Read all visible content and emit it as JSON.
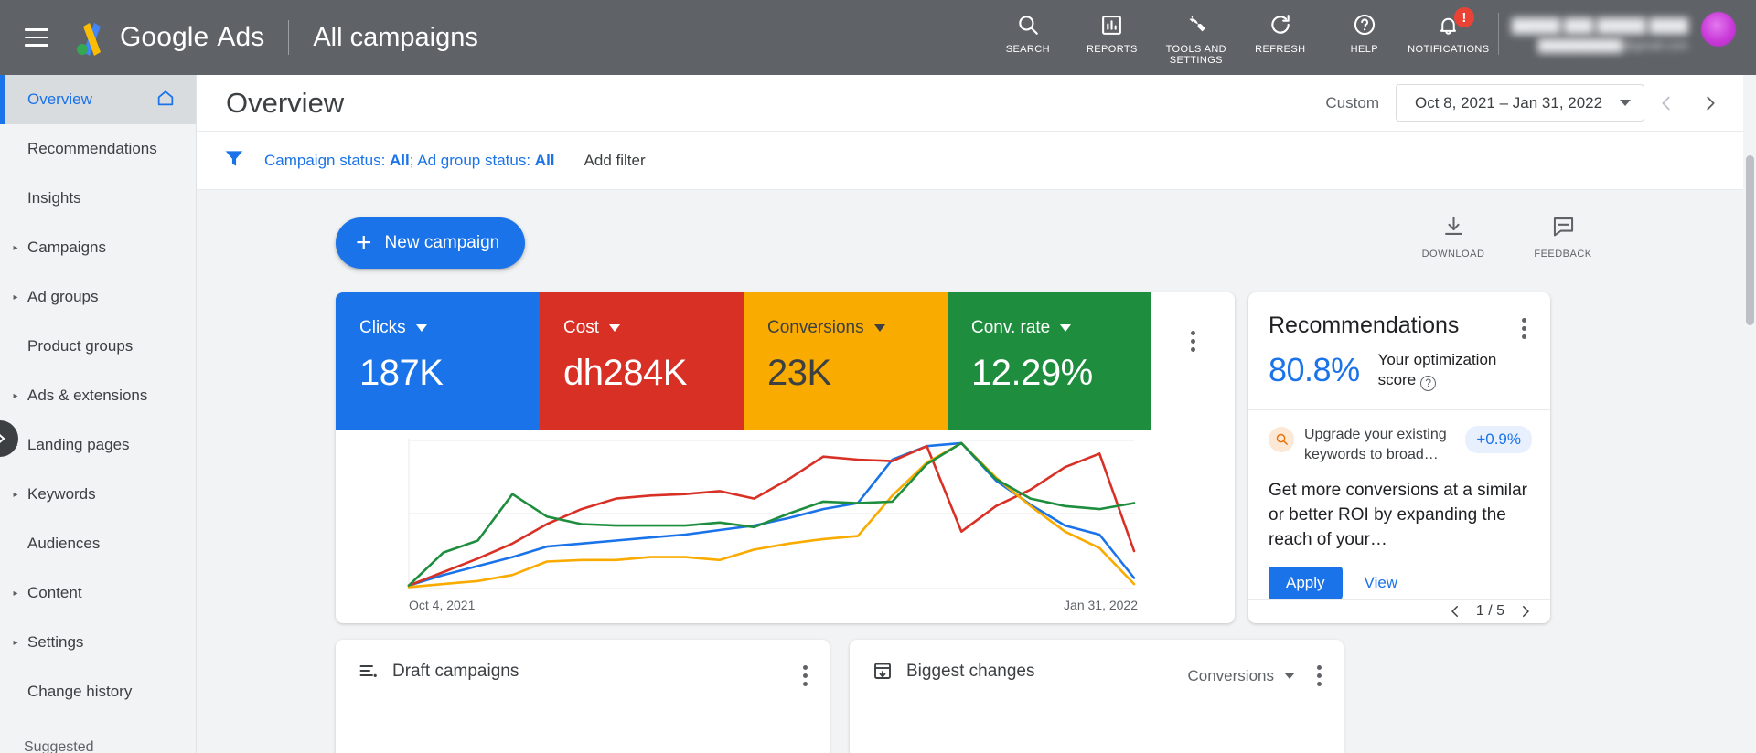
{
  "topbar": {
    "menu_icon": "hamburger-menu-icon",
    "logo_icon": "google-ads-logo",
    "brand_google": "Google",
    "brand_ads": "Ads",
    "page_context": "All campaigns",
    "actions": [
      {
        "label": "SEARCH",
        "icon": "search-icon"
      },
      {
        "label": "REPORTS",
        "icon": "bar-chart-icon"
      },
      {
        "label": "TOOLS AND SETTINGS",
        "icon": "wrench-icon"
      },
      {
        "label": "REFRESH",
        "icon": "refresh-icon"
      },
      {
        "label": "HELP",
        "icon": "help-circle-icon"
      },
      {
        "label": "NOTIFICATIONS",
        "icon": "bell-icon"
      }
    ],
    "notification_badge": "!",
    "account_name_redacted": "█████ ███ █████ ████",
    "account_email_redacted": "██████████@gmail.com",
    "avatar_icon": "user-avatar"
  },
  "sidebar": {
    "items": [
      {
        "label": "Overview",
        "expandable": false,
        "active": true,
        "trailing_icon": "home-icon"
      },
      {
        "label": "Recommendations",
        "expandable": false,
        "active": false
      },
      {
        "label": "Insights",
        "expandable": false,
        "active": false
      },
      {
        "label": "Campaigns",
        "expandable": true,
        "active": false
      },
      {
        "label": "Ad groups",
        "expandable": true,
        "active": false
      },
      {
        "label": "Product groups",
        "expandable": false,
        "active": false
      },
      {
        "label": "Ads & extensions",
        "expandable": true,
        "active": false
      },
      {
        "label": "Landing pages",
        "expandable": true,
        "active": false
      },
      {
        "label": "Keywords",
        "expandable": true,
        "active": false
      },
      {
        "label": "Audiences",
        "expandable": false,
        "active": false
      },
      {
        "label": "Content",
        "expandable": true,
        "active": false
      },
      {
        "label": "Settings",
        "expandable": true,
        "active": false
      },
      {
        "label": "Change history",
        "expandable": false,
        "active": false
      }
    ],
    "section_label": "Suggested",
    "collapse_icon": "chevron-right-icon"
  },
  "page": {
    "title": "Overview",
    "date": {
      "preset_label": "Custom",
      "range_text": "Oct 8, 2021 – Jan 31, 2022",
      "prev_icon": "chevron-left-icon",
      "next_icon": "chevron-right-icon"
    },
    "filters": {
      "filter_icon": "filter-icon",
      "chip_campaign_prefix": "Campaign status: ",
      "chip_campaign_value": "All",
      "chip_separator": "; ",
      "chip_adgroup_prefix": "Ad group status: ",
      "chip_adgroup_value": "All",
      "add_filter_label": "Add filter"
    },
    "new_campaign_label": "New campaign",
    "toolbar_actions": [
      {
        "label": "DOWNLOAD",
        "icon": "download-icon"
      },
      {
        "label": "FEEDBACK",
        "icon": "feedback-icon"
      }
    ]
  },
  "scorecards": [
    {
      "label": "Clicks",
      "value": "187K",
      "bg": "#1a73e8",
      "fg": "#ffffff"
    },
    {
      "label": "Cost",
      "value": "dh284K",
      "bg": "#d93025",
      "fg": "#ffffff"
    },
    {
      "label": "Conversions",
      "value": "23K",
      "bg": "#f9ab00",
      "fg": "#3c4043"
    },
    {
      "label": "Conv. rate",
      "value": "12.29%",
      "bg": "#1e8e3e",
      "fg": "#ffffff"
    }
  ],
  "chart_data": {
    "type": "line",
    "title": "",
    "xlabel": "",
    "ylabel": "",
    "x_tick_labels": [
      "Oct 4, 2021",
      "Jan 31, 2022"
    ],
    "x_start": "Oct 4, 2021",
    "x_end": "Jan 31, 2022",
    "grid": true,
    "gridline_count": 3,
    "legend": "none",
    "ylim": [
      0,
      100
    ],
    "x": [
      0,
      1,
      2,
      3,
      4,
      5,
      6,
      7,
      8,
      9,
      10,
      11,
      12,
      13,
      14,
      15,
      16,
      17,
      18,
      19,
      20,
      21
    ],
    "series": [
      {
        "name": "Clicks",
        "color": "#1a73e8",
        "values": [
          2,
          9,
          15,
          21,
          28,
          30,
          32,
          34,
          36,
          39,
          42,
          47,
          53,
          57,
          86,
          95,
          97,
          72,
          56,
          42,
          36,
          7
        ]
      },
      {
        "name": "Cost",
        "color": "#d93025",
        "values": [
          2,
          11,
          20,
          30,
          43,
          53,
          60,
          62,
          63,
          65,
          60,
          73,
          88,
          86,
          85,
          95,
          38,
          55,
          66,
          81,
          90,
          25
        ]
      },
      {
        "name": "Conversions",
        "color": "#f9ab00",
        "values": [
          1,
          3,
          5,
          9,
          18,
          19,
          19,
          21,
          21,
          19,
          26,
          30,
          33,
          35,
          62,
          84,
          97,
          74,
          55,
          38,
          27,
          3
        ]
      },
      {
        "name": "Conv. rate",
        "color": "#1e8e3e",
        "values": [
          2,
          24,
          32,
          63,
          48,
          43,
          42,
          42,
          42,
          44,
          41,
          50,
          58,
          57,
          58,
          83,
          97,
          73,
          60,
          55,
          53,
          57
        ]
      }
    ]
  },
  "recommendations": {
    "title": "Recommendations",
    "kebab_icon": "more-vert-icon",
    "score": "80.8%",
    "score_label_line1": "Your optimization",
    "score_label_line2": "score",
    "help_icon": "help-circle-icon",
    "item_icon": "search-icon",
    "item_text": "Upgrade your existing keywords to broad…",
    "item_pill": "+0.9%",
    "description": "Get more conversions at a similar or better ROI by expanding the reach of your…",
    "apply_label": "Apply",
    "view_label": "View",
    "pager_text": "1 / 5",
    "pager_prev_icon": "chevron-left-icon",
    "pager_next_icon": "chevron-right-icon"
  },
  "bottom_cards": [
    {
      "title": "Draft campaigns",
      "icon": "list-icon",
      "metric": null,
      "kebab_icon": "more-vert-icon"
    },
    {
      "title": "Biggest changes",
      "icon": "calendar-icon",
      "metric": "Conversions",
      "kebab_icon": "more-vert-icon"
    }
  ]
}
